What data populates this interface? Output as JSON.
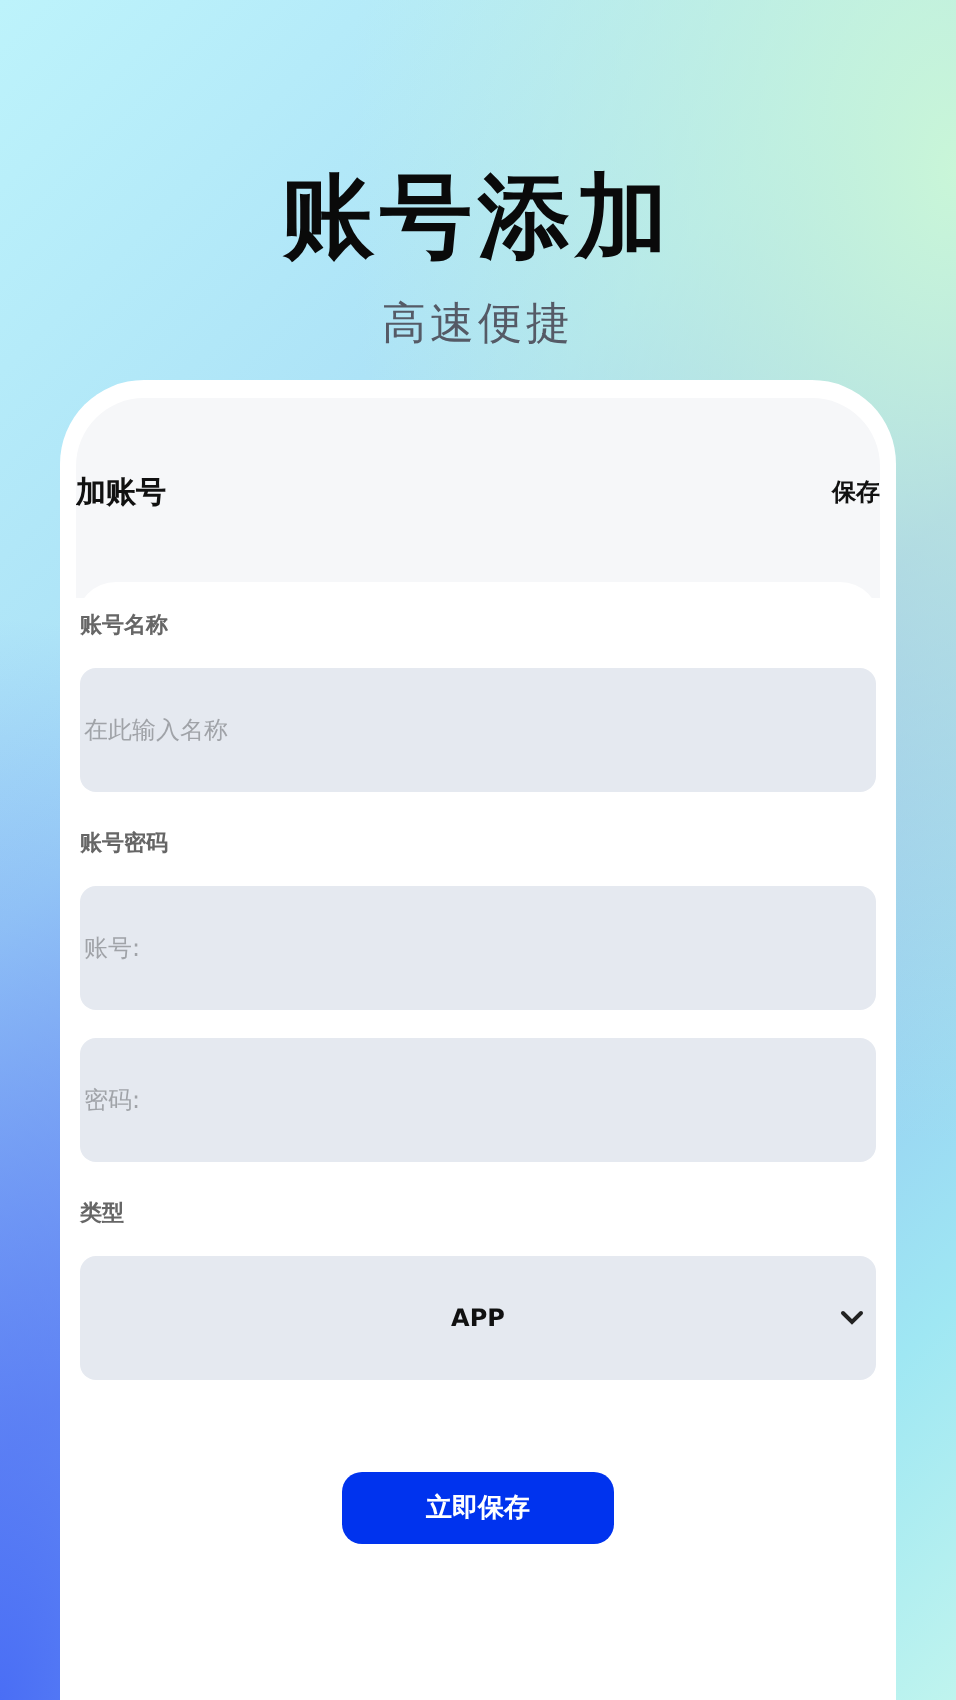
{
  "hero": {
    "title": "账号添加",
    "subtitle": "高速便捷"
  },
  "header": {
    "title": "加账号",
    "action": "保存"
  },
  "sections": [
    {
      "label": "账号名称",
      "fields": [
        {
          "kind": "input",
          "placeholder": "在此输入名称"
        }
      ]
    },
    {
      "label": "账号密码",
      "fields": [
        {
          "kind": "input",
          "placeholder": "账号:"
        },
        {
          "kind": "input",
          "placeholder": "密码:"
        }
      ]
    },
    {
      "label": "类型",
      "fields": [
        {
          "kind": "select",
          "value": "APP"
        }
      ]
    }
  ],
  "submit": "立即保存"
}
